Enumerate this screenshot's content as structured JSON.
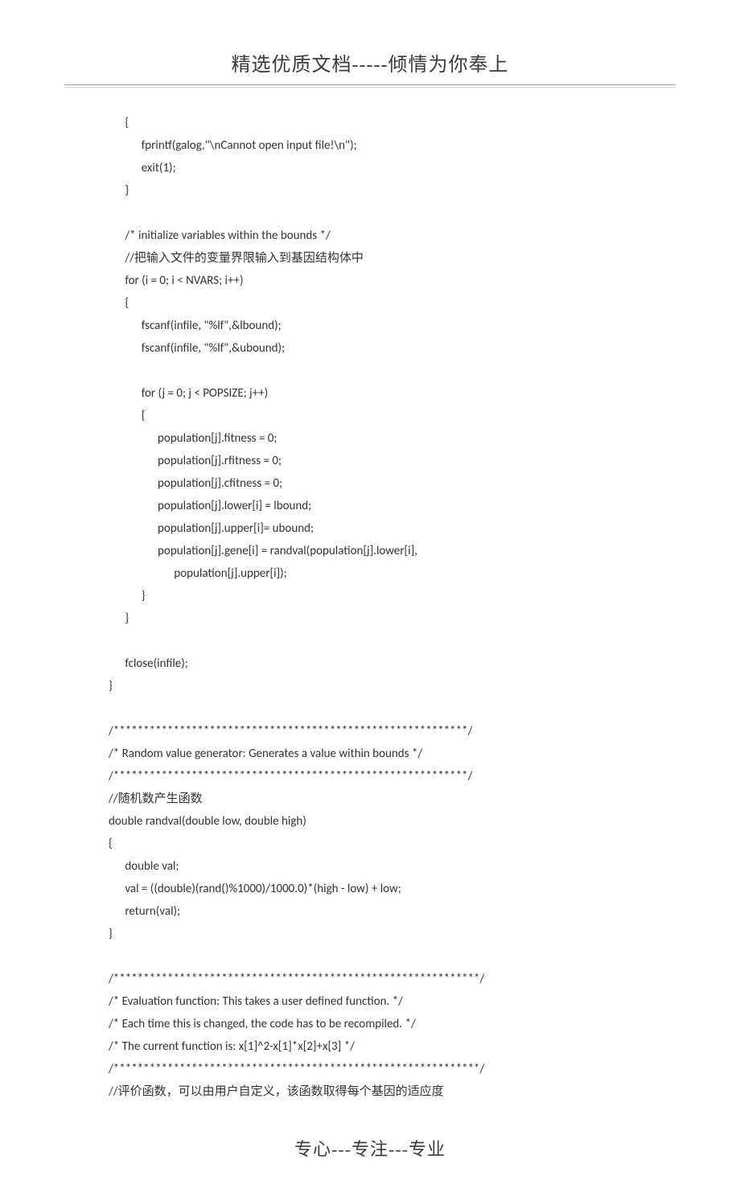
{
  "header": "精选优质文档-----倾情为你奉上",
  "footer": "专心---专注---专业",
  "code_lines": [
    "      {",
    "            fprintf(galog,\"\\nCannot open input file!\\n\");",
    "            exit(1);",
    "      }",
    "",
    "      /* initialize variables within the bounds */",
    "      //把输入文件的变量界限输入到基因结构体中",
    "      for (i = 0; i < NVARS; i++)",
    "      {",
    "            fscanf(infile, \"%lf\",&lbound);",
    "            fscanf(infile, \"%lf\",&ubound);",
    "",
    "            for (j = 0; j < POPSIZE; j++)",
    "            {",
    "                  population[j].fitness = 0;",
    "                  population[j].rfitness = 0;",
    "                  population[j].cfitness = 0;",
    "                  population[j].lower[i] = lbound;",
    "                  population[j].upper[i]= ubound;",
    "                  population[j].gene[i] = randval(population[j].lower[i],",
    "                        population[j].upper[i]);",
    "            }",
    "      }",
    "",
    "      fclose(infile);",
    "}",
    "",
    "/***********************************************************/",
    "/* Random value generator: Generates a value within bounds */",
    "/***********************************************************/",
    "//随机数产生函数",
    "double randval(double low, double high)",
    "{",
    "      double val;",
    "      val = ((double)(rand()%1000)/1000.0)*(high - low) + low;",
    "      return(val);",
    "}",
    "",
    "/*************************************************************/",
    "/* Evaluation function: This takes a user defined function. */",
    "/* Each time this is changed, the code has to be recompiled. */",
    "/* The current function is: x[1]^2-x[1]*x[2]+x[3] */",
    "/*************************************************************/",
    "//评价函数，可以由用户自定义，该函数取得每个基因的适应度"
  ]
}
